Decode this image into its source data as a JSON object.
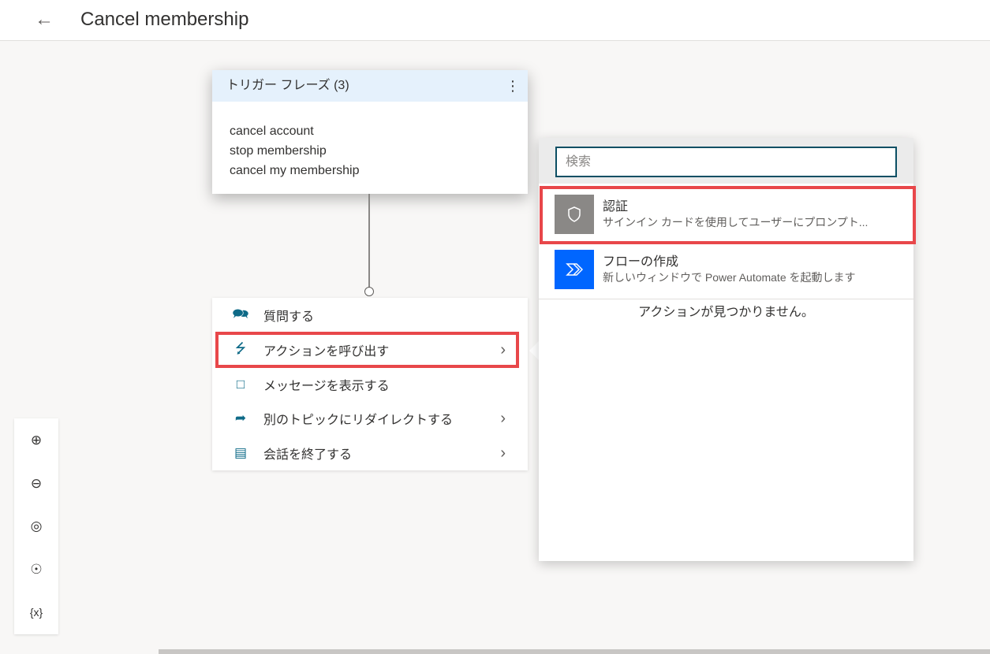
{
  "header": {
    "title": "Cancel membership",
    "back_icon": "arrow-left-icon"
  },
  "trigger": {
    "title": "トリガー フレーズ (3)",
    "phrases": [
      "cancel account",
      "stop membership",
      "cancel my membership"
    ]
  },
  "menu": {
    "items": [
      {
        "label": "質問する",
        "icon": "ask-question-icon"
      },
      {
        "label": "アクションを呼び出す",
        "icon": "lightning-icon"
      },
      {
        "label": "メッセージを表示する",
        "icon": "message-icon"
      },
      {
        "label": "別のトピックにリダイレクトする",
        "icon": "redirect-icon"
      },
      {
        "label": "会話を終了する",
        "icon": "end-conversation-icon"
      }
    ]
  },
  "flyout": {
    "search_placeholder": "検索",
    "actions": [
      {
        "title": "認証",
        "desc": "サインイン カードを使用してユーザーにプロンプト...",
        "color": "#8a8886"
      },
      {
        "title": "フローの作成",
        "desc": "新しいウィンドウで Power Automate を起動します",
        "color": "#0066ff"
      }
    ],
    "empty": "アクションが見つかりません。"
  },
  "zoom": {
    "variable_label": "{x}"
  },
  "colors": {
    "highlight": "#e8474a"
  }
}
